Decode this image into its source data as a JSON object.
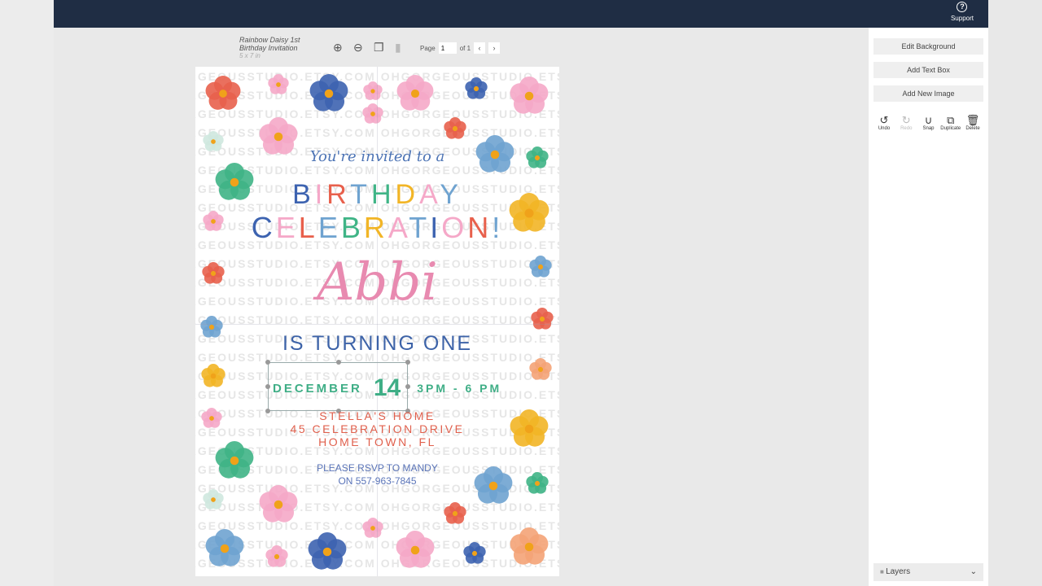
{
  "topbar": {
    "support_label": "Support",
    "support_icon": "question-circle-icon"
  },
  "document": {
    "title_line1": "Rainbow Daisy 1st",
    "title_line2": "Birthday Invitation",
    "size": "5 x 7 in"
  },
  "toolbar": {
    "zoom_in_icon": "zoom-in-icon",
    "zoom_out_icon": "zoom-out-icon",
    "copy_icon": "copy-icon",
    "delete_icon": "trash-icon"
  },
  "pager": {
    "label": "Page",
    "current": "1",
    "of": "of 1",
    "prev": "‹",
    "next": "›"
  },
  "panel": {
    "edit_background": "Edit Background",
    "add_text_box": "Add Text Box",
    "add_new_image": "Add New Image",
    "tools": [
      {
        "label": "Undo",
        "glyph": "↺"
      },
      {
        "label": "Redo",
        "glyph": "↻"
      },
      {
        "label": "Snap",
        "glyph": "∪"
      },
      {
        "label": "Duplicate",
        "glyph": "⧉"
      },
      {
        "label": "Delete",
        "glyph": "🗑"
      }
    ],
    "layers": "Layers"
  },
  "invitation": {
    "invited": "You're invited to a",
    "line1": "BIRTHDAY",
    "line2": "CELEBRATION!",
    "name": "Abbi",
    "turning": "IS TURNING ONE",
    "month": "DECEMBER",
    "day": "14",
    "time": "3PM - 6 PM",
    "place": "STELLA'S HOME",
    "street": "45 CELEBRATION DRIVE",
    "city": "HOME TOWN, FL",
    "rsvp1": "PLEASE RSVP TO MANDY",
    "rsvp2": "ON 557-963-7845",
    "watermark": "OHGORGEOUSSTUDIO.ETSY.COM",
    "colors": {
      "red": "#e8604c",
      "pink": "#f5a8c8",
      "blue": "#3d63b0",
      "lightblue": "#6fa3d0",
      "green": "#3fb486",
      "yellow": "#f2b526",
      "peach": "#f4a377",
      "mint": "#cfe8df"
    }
  }
}
